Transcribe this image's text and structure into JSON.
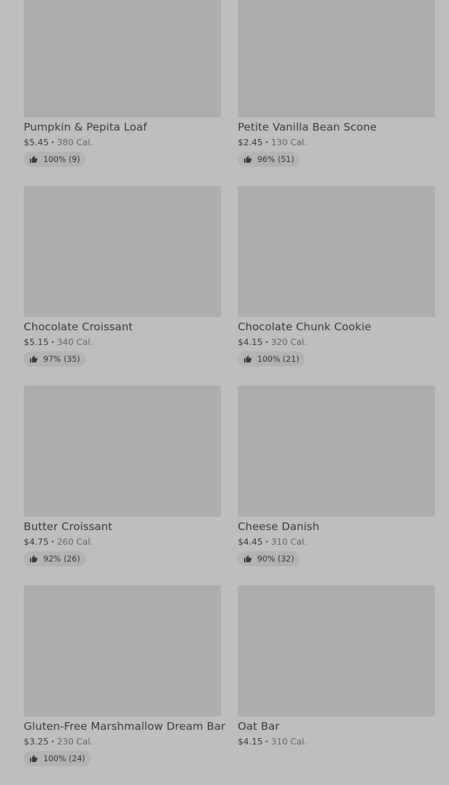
{
  "products": [
    {
      "name": "Pumpkin & Pepita Loaf",
      "price": "$5.45",
      "separator": "•",
      "calories": "380 Cal.",
      "rating": "100% (9)"
    },
    {
      "name": "Petite Vanilla Bean Scone",
      "price": "$2.45",
      "separator": "•",
      "calories": "130 Cal.",
      "rating": "96% (51)"
    },
    {
      "name": "Chocolate Croissant",
      "price": "$5.15",
      "separator": "•",
      "calories": "340 Cal.",
      "rating": "97% (35)"
    },
    {
      "name": "Chocolate Chunk Cookie",
      "price": "$4.15",
      "separator": "•",
      "calories": "320 Cal.",
      "rating": "100% (21)"
    },
    {
      "name": "Butter Croissant",
      "price": "$4.75",
      "separator": "•",
      "calories": "260 Cal.",
      "rating": "92% (26)"
    },
    {
      "name": "Cheese Danish",
      "price": "$4.45",
      "separator": "•",
      "calories": "310 Cal.",
      "rating": "90% (32)"
    },
    {
      "name": "Gluten-Free Marshmallow Dream Bar",
      "price": "$3.25",
      "separator": "•",
      "calories": "230 Cal.",
      "rating": "100% (24)"
    },
    {
      "name": "Oat Bar",
      "price": "$4.15",
      "separator": "•",
      "calories": "310 Cal.",
      "rating": ""
    }
  ],
  "icons": {
    "rating_icon": "thumbs-up-icon"
  },
  "colors": {
    "background": "#bebebe",
    "image_placeholder": "#adadad",
    "rating_pill": "#b3b3b3",
    "text_primary": "#3b3b3b"
  }
}
